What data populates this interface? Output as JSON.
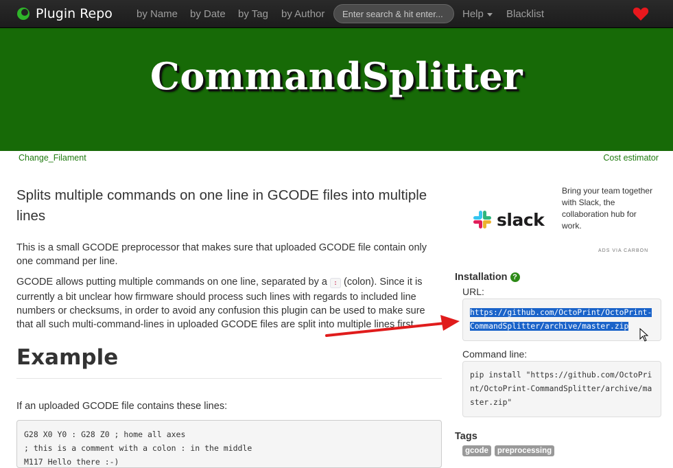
{
  "navbar": {
    "brand": "Plugin Repo",
    "links": {
      "by_name": "by Name",
      "by_date": "by Date",
      "by_tag": "by Tag",
      "by_author": "by Author",
      "help": "Help",
      "blacklist": "Blacklist"
    },
    "search_placeholder": "Enter search & hit enter...",
    "accent": "#e8181d"
  },
  "hero": {
    "title": "CommandSplitter",
    "background": "#176a07"
  },
  "pager": {
    "prev": "Change_Filament",
    "next": "Cost estimator"
  },
  "main": {
    "lead": "Splits multiple commands on one line in GCODE files into multiple lines",
    "para1": "This is a small GCODE preprocessor that makes sure that uploaded GCODE file contain only one command per line.",
    "para2_before": "GCODE allows putting multiple commands on one line, separated by a ",
    "para2_code": ":",
    "para2_after": " (colon). Since it is currently a bit unclear how firmware should process such lines with regards to included line numbers or checksums, in order to avoid any confusion this plugin can be used to make sure that all such multi-command-lines in uploaded GCODE files are split into multiple lines first.",
    "example_heading": "Example",
    "example_intro": "If an uploaded GCODE file contains these lines:",
    "code_lines": [
      "G28 X0 Y0 : G28 Z0 ; home all axes",
      "; this is a comment with a colon : in the middle",
      "M117 Hello there :-)"
    ]
  },
  "ad": {
    "brand": "slack",
    "text": "Bring your team together with Slack, the collaboration hub for work.",
    "via": "ADS VIA CARBON"
  },
  "sidebar": {
    "installation": "Installation",
    "help_icon": "?",
    "url_label": "URL:",
    "url": "https://github.com/OctoPrint/OctoPrint-CommandSplitter/archive/master.zip",
    "cmd_label": "Command line:",
    "cmd": "pip install \"https://github.com/OctoPrint/OctoPrint-CommandSplitter/archive/master.zip\"",
    "tags_heading": "Tags",
    "tags": [
      "gcode",
      "preprocessing"
    ]
  }
}
